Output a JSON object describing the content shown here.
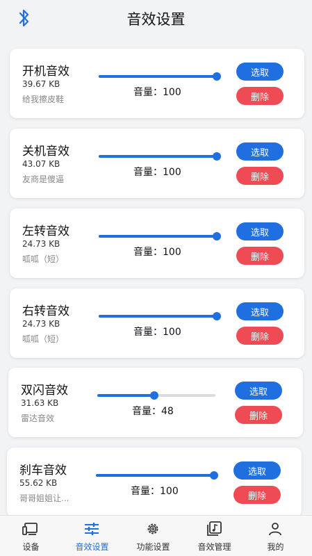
{
  "header": {
    "title": "音效设置",
    "bluetooth_icon": "bluetooth-icon"
  },
  "colors": {
    "accent": "#1f6fe0",
    "danger": "#ee4b55",
    "background": "#f2f3f5"
  },
  "sounds": [
    {
      "name": "开机音效",
      "size": "39.67 KB",
      "desc": "给我擦皮鞋",
      "volume_text": "音量：100",
      "volume": 100,
      "select_label": "选取",
      "delete_label": "删除"
    },
    {
      "name": "关机音效",
      "size": "43.07 KB",
      "desc": "友商是傻逼",
      "volume_text": "音量：100",
      "volume": 100,
      "select_label": "选取",
      "delete_label": "删除"
    },
    {
      "name": "左转音效",
      "size": "24.73 KB",
      "desc": "呱呱（短）",
      "volume_text": "音量：100",
      "volume": 100,
      "select_label": "选取",
      "delete_label": "删除"
    },
    {
      "name": "右转音效",
      "size": "24.73 KB",
      "desc": "呱呱（短）",
      "volume_text": "音量：100",
      "volume": 100,
      "select_label": "选取",
      "delete_label": "删除"
    },
    {
      "name": "双闪音效",
      "size": "31.63 KB",
      "desc": "雷达音效",
      "volume_text": "音量：48",
      "volume": 48,
      "select_label": "选取",
      "delete_label": "删除"
    },
    {
      "name": "刹车音效",
      "size": "55.62 KB",
      "desc": "哥哥姐姐让...",
      "volume_text": "音量：100",
      "volume": 100,
      "select_label": "选取",
      "delete_label": "删除"
    }
  ],
  "tabbar": {
    "active": "音效设置",
    "items": [
      {
        "label": "设备",
        "icon": "device-icon"
      },
      {
        "label": "音效设置",
        "icon": "sliders-icon"
      },
      {
        "label": "功能设置",
        "icon": "gear-icon"
      },
      {
        "label": "音效管理",
        "icon": "music-library-icon"
      },
      {
        "label": "我的",
        "icon": "user-icon"
      }
    ]
  }
}
